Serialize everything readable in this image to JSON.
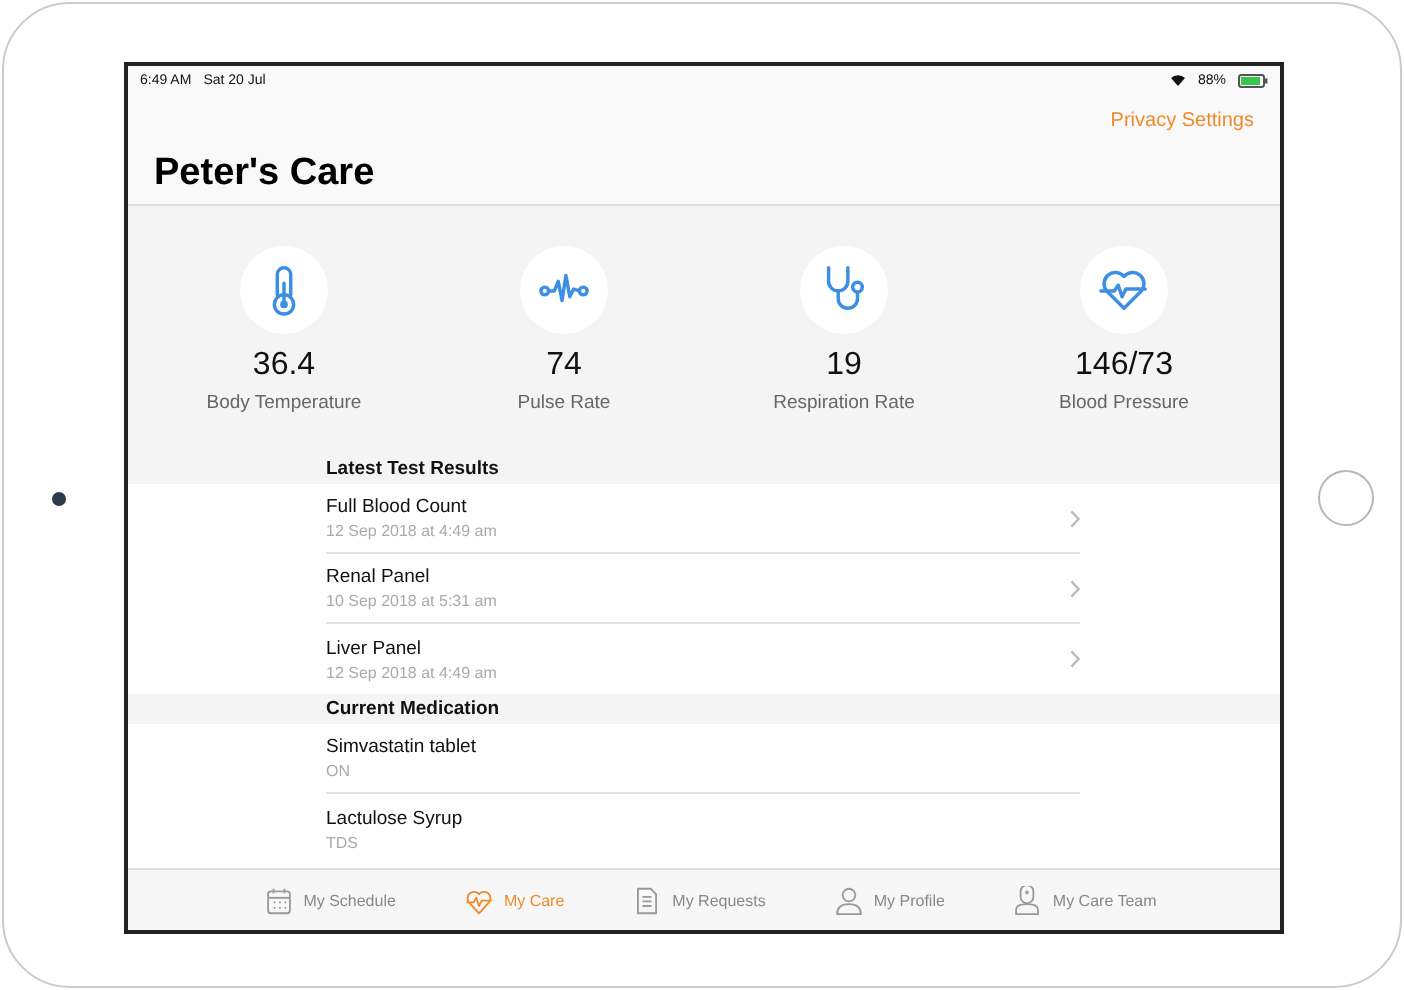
{
  "status_bar": {
    "time": "6:49 AM",
    "date": "Sat 20 Jul",
    "battery": "88%"
  },
  "nav": {
    "action": "Privacy Settings",
    "title": "Peter's Care"
  },
  "vitals": [
    {
      "kind": "temperature",
      "value": "36.4",
      "label": "Body Temperature"
    },
    {
      "kind": "pulse",
      "value": "74",
      "label": "Pulse Rate"
    },
    {
      "kind": "respiration",
      "value": "19",
      "label": "Respiration Rate"
    },
    {
      "kind": "pressure",
      "value": "146/73",
      "label": "Blood Pressure"
    }
  ],
  "sections": [
    {
      "title": "Latest Test Results",
      "rows": [
        {
          "title": "Full Blood Count",
          "subtitle": "12 Sep 2018 at 4:49 am",
          "chevron": true
        },
        {
          "title": "Renal Panel",
          "subtitle": "10 Sep 2018 at 5:31 am",
          "chevron": true
        },
        {
          "title": "Liver Panel",
          "subtitle": "12 Sep 2018 at 4:49 am",
          "chevron": true
        }
      ]
    },
    {
      "title": "Current Medication",
      "rows": [
        {
          "title": "Simvastatin tablet",
          "subtitle": "ON",
          "chevron": false
        },
        {
          "title": "Lactulose Syrup",
          "subtitle": "TDS",
          "chevron": false
        }
      ]
    }
  ],
  "tab_bar": [
    {
      "kind": "schedule",
      "label": "My Schedule",
      "selected": false
    },
    {
      "kind": "care",
      "label": "My Care",
      "selected": true
    },
    {
      "kind": "requests",
      "label": "My Requests",
      "selected": false
    },
    {
      "kind": "profile",
      "label": "My Profile",
      "selected": false
    },
    {
      "kind": "team",
      "label": "My Care Team",
      "selected": false
    }
  ]
}
